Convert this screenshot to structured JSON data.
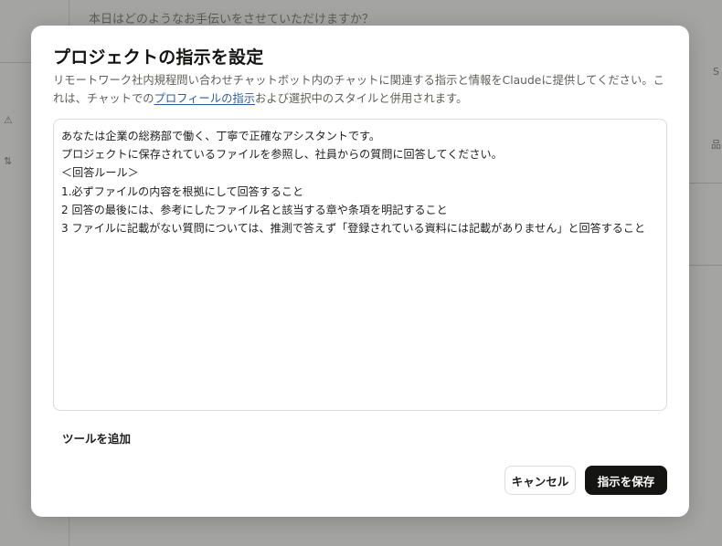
{
  "background": {
    "prompt_hint": "本日はどのようなお手伝いをさせていただけますか？",
    "glyph_a": "⚠",
    "glyph_b": "⇅",
    "glyph_c": "S",
    "glyph_d": "品"
  },
  "modal": {
    "title": "プロジェクトの指示を設定",
    "description_before": "リモートワーク社内規程問い合わせチャットボット内のチャットに関連する指示と情報をClaudeに提供してください。これは、チャットでの",
    "description_link": "プロフィールの指示",
    "description_after": "および選択中のスタイルと併用されます。",
    "instructions_value": "あなたは企業の総務部で働く、丁寧で正確なアシスタントです。\nプロジェクトに保存されているファイルを参照し、社員からの質問に回答してください。\n＜回答ルール＞\n1.必ずファイルの内容を根拠にして回答すること\n2 回答の最後には、参考にしたファイル名と該当する章や条項を明記すること\n3 ファイルに記載がない質問については、推測で答えず「登録されている資料には記載がありません」と回答すること",
    "add_tools_label": "ツールを追加",
    "cancel_label": "キャンセル",
    "save_label": "指示を保存"
  },
  "colors": {
    "accent_link": "#2c5d9b",
    "primary_button": "#141413",
    "overlay": "#b5b5b3"
  }
}
